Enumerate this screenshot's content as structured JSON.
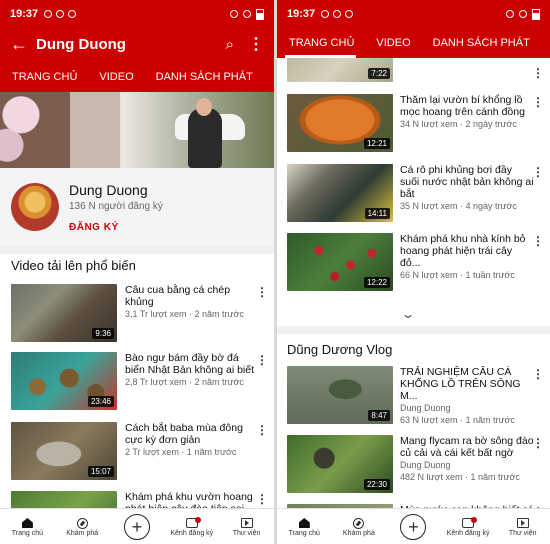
{
  "status": {
    "time_left": "19:37",
    "time_right": "19:37"
  },
  "left": {
    "header": {
      "title": "Dung Duong"
    },
    "tabs": [
      "TRANG CHỦ",
      "VIDEO",
      "DANH SÁCH PHÁT",
      "CỘ"
    ],
    "channel": {
      "name": "Dung Duong",
      "subscribers": "136 N người đăng ký",
      "subscribe_label": "ĐĂNG KÝ"
    },
    "section_title": "Video tải lên phổ biến",
    "videos": [
      {
        "title": "Câu cua bằng cá chép khủng",
        "meta": "3,1 Tr lượt xem · 2 năm trước",
        "duration": "9:36"
      },
      {
        "title": "Bào ngư bám đầy bờ đá biển Nhật Bản không ai biết",
        "meta": "2,8 Tr lượt xem · 2 năm trước",
        "duration": "23:46"
      },
      {
        "title": "Cách bắt baba mùa đông cực kỳ đơn giản",
        "meta": "2 Tr lượt xem · 1 năm trước",
        "duration": "15:07"
      },
      {
        "title": "Khám phá khu vườn hoang phát hiện cây đào tiên sai c...",
        "meta": "",
        "duration": ""
      }
    ]
  },
  "right": {
    "tabs": [
      "TRANG CHỦ",
      "VIDEO",
      "DANH SÁCH PHÁT",
      "C"
    ],
    "partial_duration": "7:22",
    "videos": [
      {
        "title": "Thăm lại vườn bí khổng lồ mọc hoang trên cánh đồng",
        "meta": "34 N lượt xem · 2 ngày trước",
        "duration": "12:21"
      },
      {
        "title": "Cá rô phi khủng bơi đầy suối nước nhật bản không ai bắt",
        "meta": "35 N lượt xem · 4 ngày trước",
        "duration": "14:11"
      },
      {
        "title": "Khám phá khu nhà kính bỏ hoang phát hiện trái cây đỏ...",
        "meta": "66 N lượt xem · 1 tuần trước",
        "duration": "12:22"
      }
    ],
    "vlog_title": "Dũng Dương Vlog",
    "vlog_videos": [
      {
        "title": "TRẢI NGHIỆM CÂU CÁ KHỔNG LỒ TRÊN SÔNG M...",
        "channel": "Dung Duong",
        "meta": "63 N lượt xem · 1 năm trước",
        "duration": "8:47"
      },
      {
        "title": "Mang flycam ra bờ sông đào củ cải và cái kết bất ngờ",
        "channel": "Dung Duong",
        "meta": "482 N lượt xem · 1 năm trước",
        "duration": "22:30"
      },
      {
        "title": "Mùa nước can không biết cá",
        "channel": "",
        "meta": "",
        "duration": ""
      }
    ]
  },
  "bottom_nav": [
    "Trang chủ",
    "Khám phá",
    "Kênh đăng ký",
    "Thư viện"
  ],
  "colors": {
    "brand": "#cc0000"
  }
}
